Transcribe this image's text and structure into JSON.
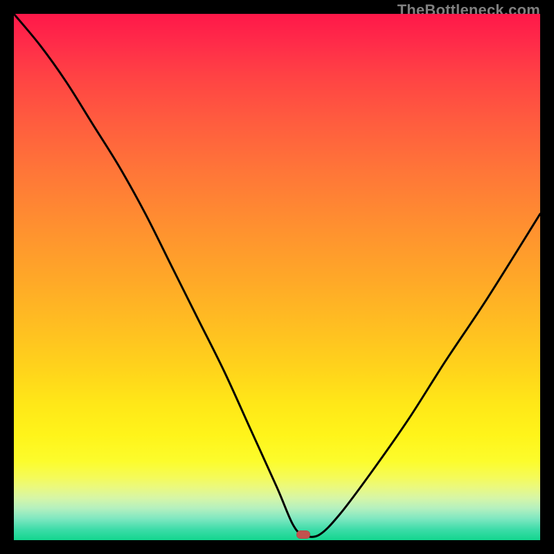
{
  "watermark": "TheBottleneck.com",
  "colors": {
    "curve_stroke": "#000000",
    "marker_fill": "#c1524e",
    "background_black": "#000000"
  },
  "chart_data": {
    "type": "line",
    "title": "",
    "xlabel": "",
    "ylabel": "",
    "xlim": [
      0,
      100
    ],
    "ylim": [
      0,
      100
    ],
    "background": "gradient red→green (bottleneck heatmap)",
    "annotations": [
      {
        "kind": "marker",
        "shape": "rounded-pill",
        "x": 55,
        "y": 1
      }
    ],
    "series": [
      {
        "name": "bottleneck-curve",
        "x": [
          0,
          5,
          10,
          15,
          20,
          25,
          30,
          35,
          40,
          45,
          50,
          53,
          55,
          58,
          62,
          68,
          75,
          82,
          90,
          100
        ],
        "y": [
          100,
          94,
          87,
          79,
          71,
          62,
          52,
          42,
          32,
          21,
          10,
          3,
          1,
          1,
          5,
          13,
          23,
          34,
          46,
          62
        ]
      }
    ]
  }
}
